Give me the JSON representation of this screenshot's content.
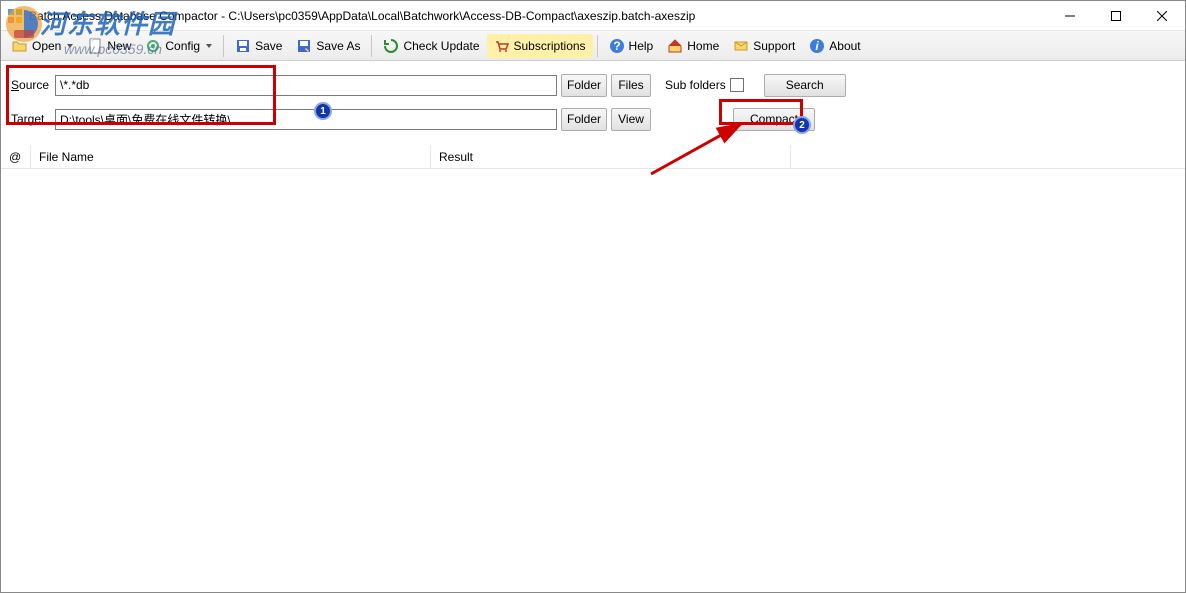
{
  "titlebar": {
    "title": "Batch Access Database Compactor - C:\\Users\\pc0359\\AppData\\Local\\Batchwork\\Access-DB-Compact\\axeszip.batch-axeszip"
  },
  "toolbar": {
    "open": "Open",
    "new": "New",
    "config": "Config",
    "save": "Save",
    "save_as": "Save As",
    "check_update": "Check Update",
    "subscriptions": "Subscriptions",
    "help": "Help",
    "home": "Home",
    "support": "Support",
    "about": "About"
  },
  "rows": {
    "source_label_ul": "S",
    "source_label_rest": "ource",
    "source_value": "\\*.*db",
    "target_label_ul": "T",
    "target_label_rest": "arget",
    "target_value": "D:\\tools\\桌面\\免费在线文件转换\\",
    "folder": "Folder",
    "files": "Files",
    "view": "View",
    "sub_folders": "Sub folders",
    "search": "Search",
    "compact": "Compact"
  },
  "list": {
    "at": "@",
    "file_name": "File Name",
    "result": "Result"
  },
  "watermark": {
    "main": "河东软件园",
    "url": "www.pc0359.cn"
  },
  "badges": {
    "one": "1",
    "two": "2"
  }
}
